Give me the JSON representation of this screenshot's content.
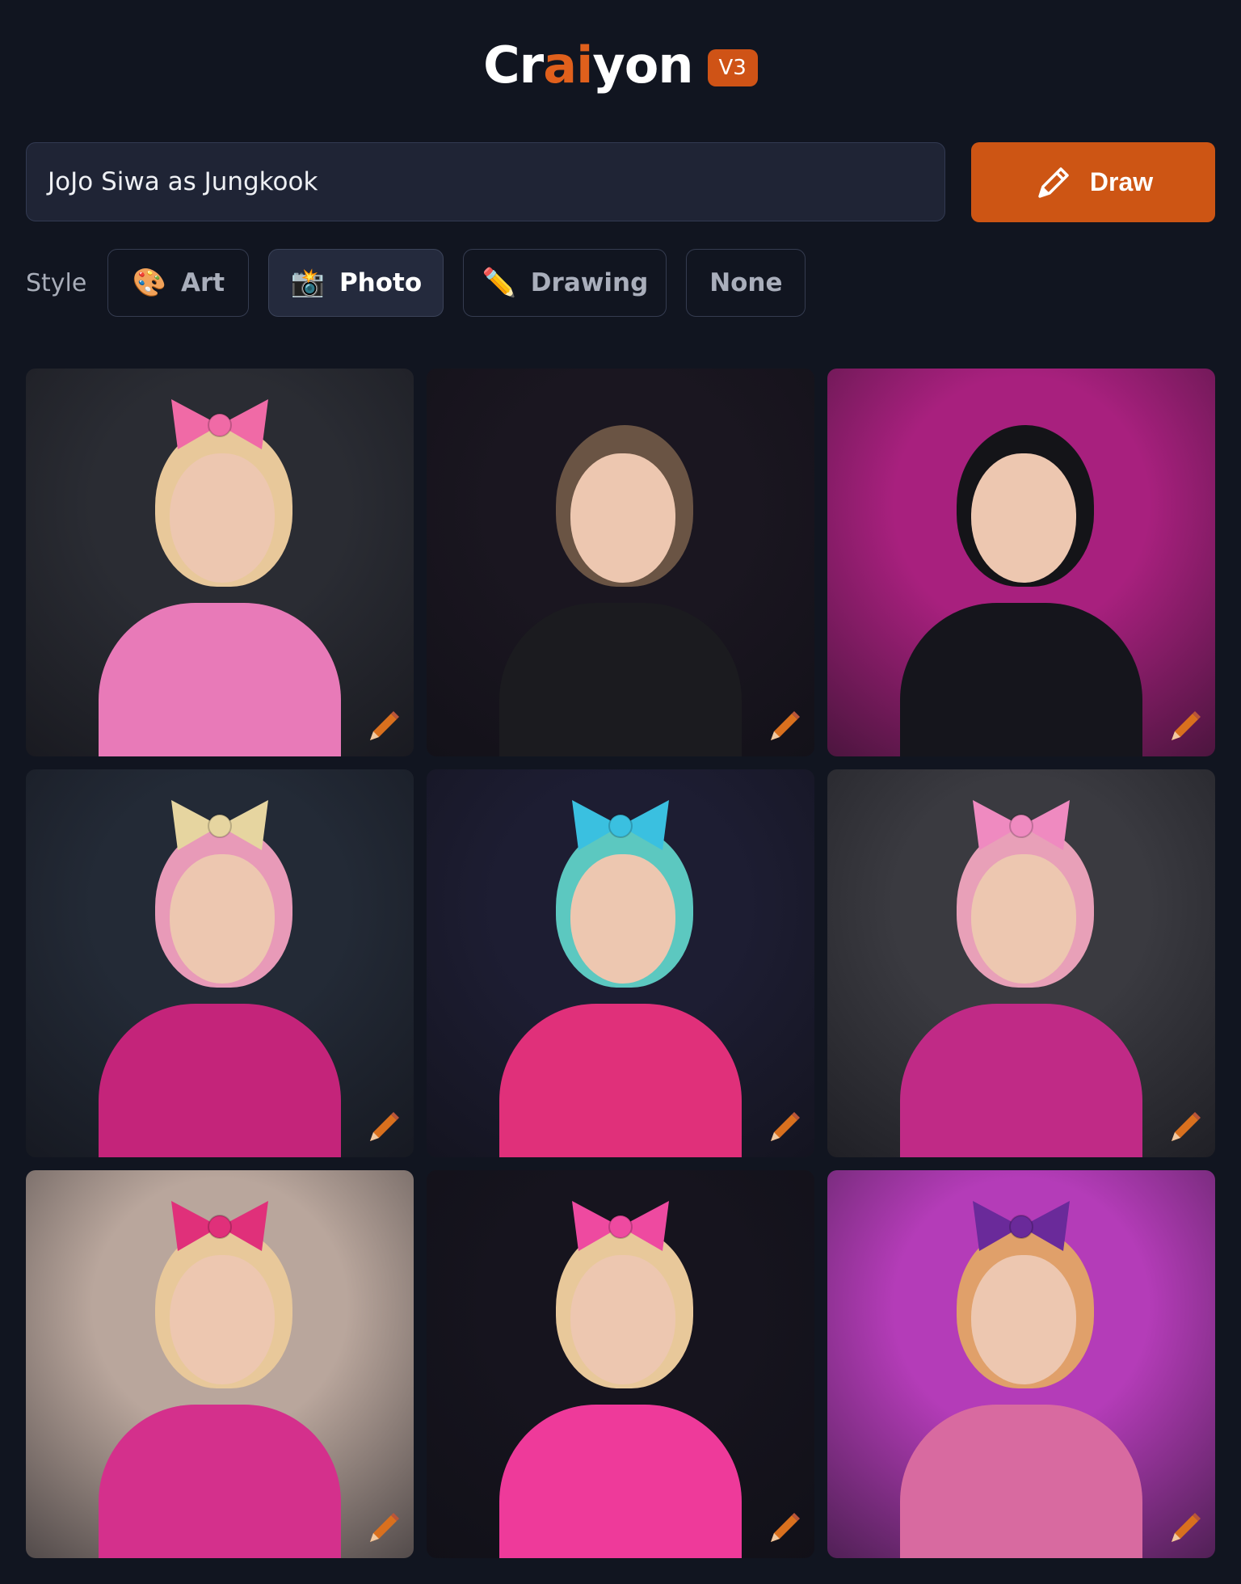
{
  "header": {
    "logo_part1": "Cr",
    "logo_accent": "ai",
    "logo_part2": "yon",
    "version": "V3"
  },
  "prompt": {
    "value": "JoJo Siwa as Jungkook"
  },
  "draw_button": {
    "label": "Draw",
    "icon": "pencil-icon"
  },
  "style": {
    "label": "Style",
    "selected": "Photo",
    "options": [
      {
        "icon": "palette-icon",
        "emoji": "🎨",
        "label": "Art"
      },
      {
        "icon": "camera-flash-icon",
        "emoji": "📸",
        "label": "Photo"
      },
      {
        "icon": "pencil-icon",
        "emoji": "✏️",
        "label": "Drawing"
      },
      {
        "icon": "",
        "emoji": "",
        "label": "None"
      }
    ]
  },
  "grid": {
    "images": [
      {
        "bg": "#2a2c33",
        "subject": "#e87ab8",
        "hair": "#e8c89a",
        "bow": "#f06aa6"
      },
      {
        "bg": "#1a1620",
        "subject": "#1b1b1f",
        "hair": "#6a5444",
        "bow": ""
      },
      {
        "bg": "#a8207e",
        "subject": "#15151c",
        "hair": "#141418",
        "bow": ""
      },
      {
        "bg": "#232a36",
        "subject": "#c4247a",
        "hair": "#e89ab8",
        "bow": "#e6d5a0"
      },
      {
        "bg": "#1d1d32",
        "subject": "#e0307a",
        "hair": "#5cc8c0",
        "bow": "#3ac0e0"
      },
      {
        "bg": "#3a3a40",
        "subject": "#c02a86",
        "hair": "#e8a0b8",
        "bow": "#ef8ac0"
      },
      {
        "bg": "#b9a69c",
        "subject": "#d4308c",
        "hair": "#e8c89a",
        "bow": "#e0307a"
      },
      {
        "bg": "#16141e",
        "subject": "#ee3a9a",
        "hair": "#e8c89a",
        "bow": "#ee4aa0"
      },
      {
        "bg": "#b43cb8",
        "subject": "#d86aa0",
        "hair": "#e0a06a",
        "bow": "#6a2a9a"
      }
    ],
    "edit_icon": "pencil-icon",
    "accent": "#d9701e"
  }
}
